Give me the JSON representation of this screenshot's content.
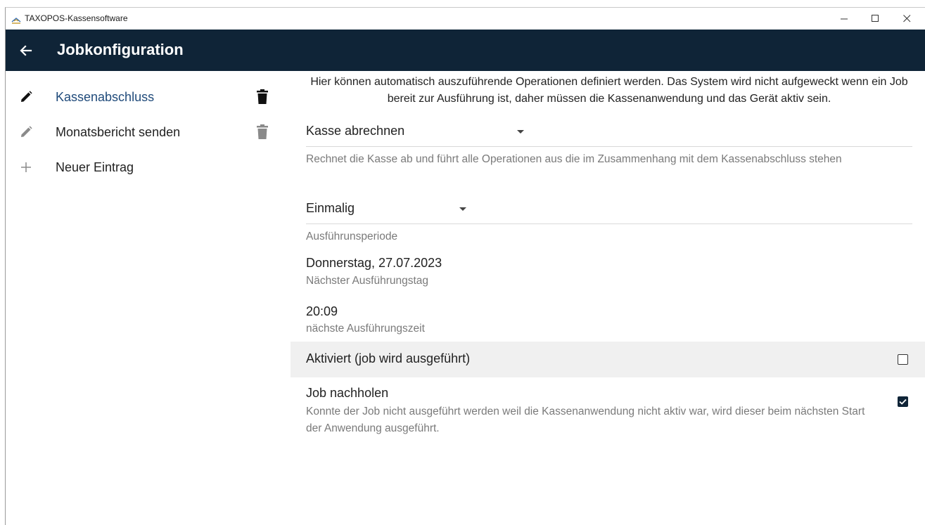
{
  "window": {
    "title": "TAXOPOS-Kassensoftware",
    "app_icon": "taxopos-logo-icon",
    "controls": [
      "minimize-icon",
      "maximize-icon",
      "close-icon"
    ]
  },
  "appbar": {
    "back_icon": "arrow-left-icon",
    "title": "Jobkonfiguration",
    "color": "#0f2437"
  },
  "sidebar": {
    "items": [
      {
        "label": "Kassenabschluss",
        "icon": "pencil-icon",
        "selected": true,
        "deletable": true
      },
      {
        "label": "Monatsbericht senden",
        "icon": "pencil-icon",
        "selected": false,
        "deletable": true
      },
      {
        "label": "Neuer Eintrag",
        "icon": "plus-icon",
        "selected": false,
        "deletable": false
      }
    ]
  },
  "main": {
    "intro": "Hier können automatisch auszuführende Operationen definiert werden. Das System wird nicht aufgeweckt wenn ein Job bereit zur Ausführung ist, daher müssen die Kassenanwendung und das Gerät aktiv sein.",
    "operation": {
      "value": "Kasse abrechnen",
      "description": "Rechnet die Kasse ab und führt alle Operationen aus die im Zusammenhang mit dem Kassenabschluss stehen"
    },
    "period": {
      "value": "Einmalig",
      "caption": "Ausführunsperiode"
    },
    "next_day": {
      "value": "Donnerstag, 27.07.2023",
      "caption": "Nächster Ausführungstag"
    },
    "next_time": {
      "value": "20:09",
      "caption": "nächste Ausführungszeit"
    },
    "activated": {
      "label": "Aktiviert (job wird ausgeführt)",
      "checked": false
    },
    "catch_up": {
      "label": "Job nachholen",
      "description": "Konnte der Job nicht ausgeführt werden weil die Kassenanwendung nicht aktiv war, wird dieser beim nächsten Start der Anwendung ausgeführt.",
      "checked": true
    }
  }
}
